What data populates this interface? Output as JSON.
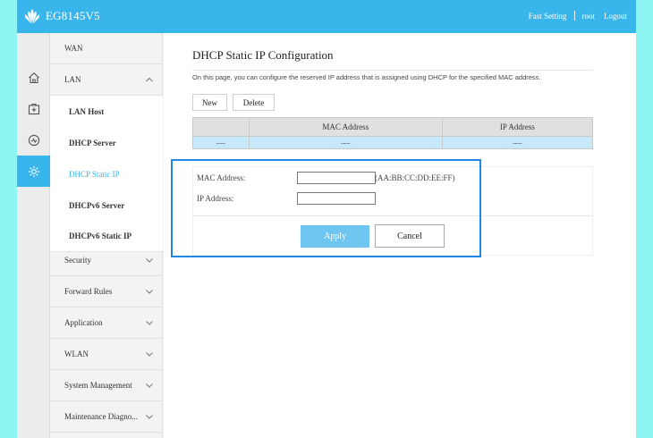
{
  "app": {
    "brand": "EG8145V5",
    "top_links": [
      "Fast Setting",
      "root",
      "Logout"
    ]
  },
  "colors": {
    "accent": "#38b5eb",
    "background": "#8ff5f2",
    "apply_button": "#6ec6f0",
    "selected_row": "#c6e8fb",
    "highlight_box": "#1e88e5"
  },
  "icon_rail": [
    "home-icon",
    "medical-box-icon",
    "gauge-icon",
    "gear-icon"
  ],
  "sidebar": {
    "items": [
      {
        "label": "WAN",
        "expandable": false
      },
      {
        "label": "LAN",
        "expandable": true,
        "expanded": true
      },
      {
        "label": "LAN Host",
        "sub": true
      },
      {
        "label": "DHCP Server",
        "sub": true
      },
      {
        "label": "DHCP Static IP",
        "sub": true,
        "active": true
      },
      {
        "label": "DHCPv6 Server",
        "sub": true
      },
      {
        "label": "DHCPv6 Static IP",
        "sub": true
      },
      {
        "label": "Security",
        "expandable": true
      },
      {
        "label": "Forward Rules",
        "expandable": true
      },
      {
        "label": "Application",
        "expandable": true
      },
      {
        "label": "WLAN",
        "expandable": true
      },
      {
        "label": "System Management",
        "expandable": true
      },
      {
        "label": "Maintenance Diagno...",
        "expandable": true
      }
    ]
  },
  "page": {
    "title": "DHCP Static IP Configuration",
    "description": "On this page, you can configure the reserved IP address that is assigned using DHCP for the specified MAC address."
  },
  "toolbar": {
    "new_label": "New",
    "delete_label": "Delete"
  },
  "table": {
    "headers": [
      "",
      "MAC Address",
      "IP Address"
    ],
    "rows": [
      [
        "----",
        "----",
        "----"
      ]
    ]
  },
  "form": {
    "mac_label": "MAC Address:",
    "mac_value": "",
    "mac_hint": "(AA:BB:CC:DD:EE:FF)",
    "ip_label": "IP Address:",
    "ip_value": "",
    "apply_label": "Apply",
    "cancel_label": "Cancel"
  }
}
